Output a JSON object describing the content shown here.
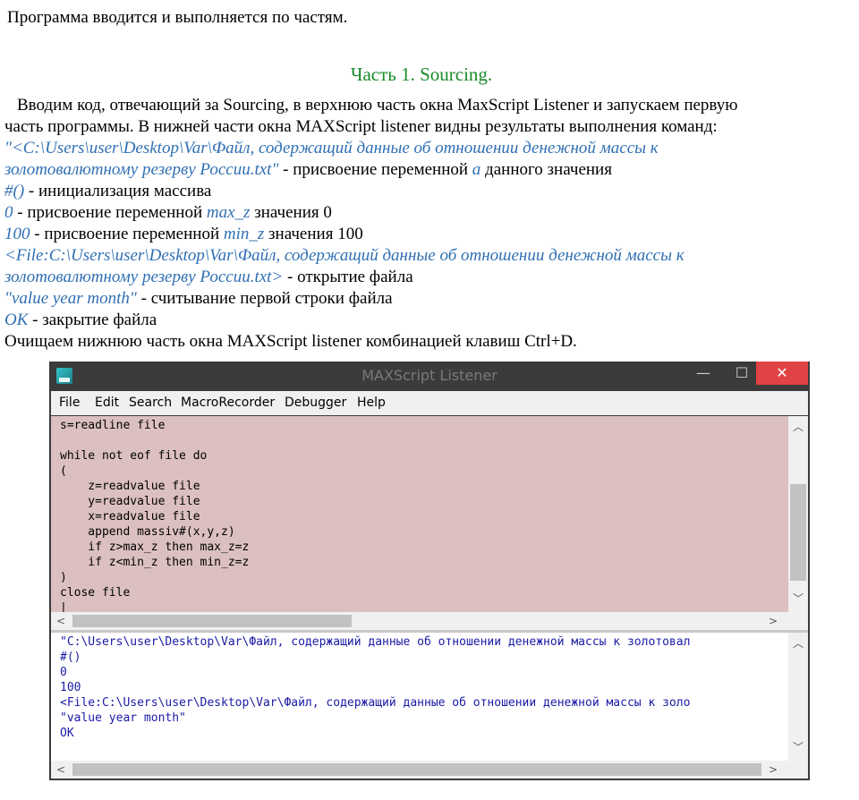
{
  "intro": "Программа вводится и выполняется по частям.",
  "heading": "Часть 1. Sourcing.",
  "paragraph": {
    "line1": "Вводим код, отвечающий за Sourcing, в верхнюю часть окна MaxScript Listener и запускаем первую",
    "line2": "часть программы. В нижней  части окна MAXScript listener видны результаты выполнения команд:",
    "item1_em": "\"<C:\\Users\\user\\Desktop\\Var\\Файл, содержащий данные об отношении денежной массы к",
    "item1_em2": "золотовалютному резерву России.txt\"",
    "item1_text": " - присвоение переменной ",
    "item1_var": "a",
    "item1_tail": " данного значения",
    "item2_em": "#()",
    "item2_text": " - инициализация массива",
    "item3_em": "0",
    "item3_text": " - присвоение переменной ",
    "item3_var": "max_z",
    "item3_tail": " значения 0",
    "item4_em": "100",
    "item4_text": " - присвоение переменной ",
    "item4_var": "min_z",
    "item4_tail": " значения 100",
    "item5_em": "<File:C:\\Users\\user\\Desktop\\Var\\Файл, содержащий данные об отношении денежной массы к",
    "item5_em2": "золотовалютному резерву России.txt>",
    "item5_text": " - открытие файла",
    "item6_em": "\"value year month\"",
    "item6_text": " - считывание первой строки файла",
    "item7_em": "OK",
    "item7_text": " - закрытие файла",
    "closing": "Очищаем нижнюю часть окна MAXScript listener комбинацией клавиш Ctrl+D."
  },
  "window": {
    "title": "MAXScript Listener",
    "min_glyph": "—",
    "max_glyph": "☐",
    "close_glyph": "✕",
    "icon": "max-app-icon",
    "menu": [
      "File",
      "Edit",
      "Search",
      "MacroRecorder",
      "Debugger",
      "Help"
    ],
    "top_code": "s=readline file\n\nwhile not eof file do\n(\n    z=readvalue file\n    y=readvalue file\n    x=readvalue file\n    append massiv#(x,y,z)\n    if z>max_z then max_z=z\n    if z<min_z then min_z=z\n)\nclose file\n|",
    "bottom_output": "\"C:\\Users\\user\\Desktop\\Var\\Файл, содержащий данные об отношении денежной массы к золотовал\n#()\n0\n100\n<File:C:\\Users\\user\\Desktop\\Var\\Файл, содержащий данные об отношении денежной массы к золо\n\"value year month\"\nOK",
    "arrow_up": "︿",
    "arrow_down": "﹀",
    "arrow_left": "<",
    "arrow_right": ">"
  }
}
